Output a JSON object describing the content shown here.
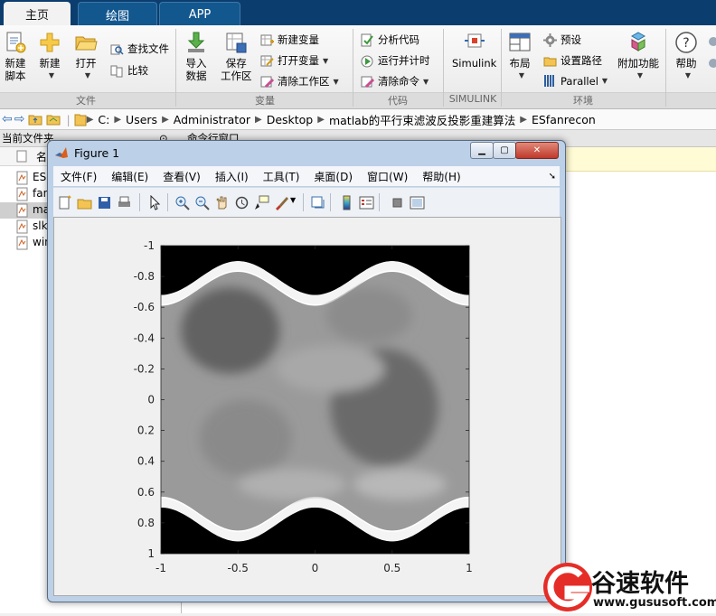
{
  "tabs": [
    {
      "label": "主页",
      "active": true
    },
    {
      "label": "绘图",
      "active": false
    },
    {
      "label": "APP",
      "active": false
    }
  ],
  "ribbon": {
    "file": {
      "new_script": "新建\n脚本",
      "new": "新建",
      "open": "打开",
      "find_files": "查找文件",
      "compare": "比较",
      "group": "文件"
    },
    "variable": {
      "import": "导入\n数据",
      "save_ws": "保存\n工作区",
      "new_var": "新建变量",
      "open_var": "打开变量",
      "clear_ws": "清除工作区",
      "group": "变量"
    },
    "code": {
      "analyze": "分析代码",
      "run_time": "运行并计时",
      "clear_cmd": "清除命令",
      "group": "代码"
    },
    "simulink": {
      "label": "Simulink",
      "group": "SIMULINK"
    },
    "env": {
      "layout": "布局",
      "prefs": "预设",
      "set_path": "设置路径",
      "parallel": "Parallel",
      "addons": "附加功能",
      "group": "环境"
    },
    "resources": {
      "help": "帮助"
    }
  },
  "address": {
    "crumbs": [
      "C:",
      "Users",
      "Administrator",
      "Desktop",
      "matlab的平行束滤波反投影重建算法",
      "ESfanrecon"
    ]
  },
  "left_panel": {
    "title": "当前文件夹",
    "column": "名",
    "files": [
      "ES",
      "fan",
      "ma",
      "slk",
      "win"
    ]
  },
  "right_panel": {
    "title": "命令行窗口"
  },
  "figure": {
    "title": "Figure 1",
    "menu": [
      "文件(F)",
      "编辑(E)",
      "查看(V)",
      "插入(I)",
      "工具(T)",
      "桌面(D)",
      "窗口(W)",
      "帮助(H)"
    ],
    "tools": [
      "new-figure-icon",
      "open-icon",
      "save-icon",
      "print-icon",
      "pointer-icon",
      "zoom-in-icon",
      "zoom-out-icon",
      "pan-icon",
      "rotate-icon",
      "data-cursor-icon",
      "brush-icon",
      "link-icon",
      "colorbar-icon",
      "legend-icon",
      "hide-tools-icon",
      "show-tools-icon"
    ]
  },
  "chart_data": {
    "type": "heatmap",
    "title": "",
    "xlabel": "",
    "ylabel": "",
    "xlim": [
      -1,
      1
    ],
    "ylim": [
      1,
      -1
    ],
    "y_reversed": true,
    "xticks": [
      "-1",
      "-0.5",
      "0",
      "0.5",
      "1"
    ],
    "yticks": [
      "-1",
      "-0.8",
      "-0.6",
      "-0.4",
      "-0.2",
      "0",
      "0.2",
      "0.4",
      "0.6",
      "0.8",
      "1"
    ],
    "colormap": "gray",
    "description_values": {
      "sinusoid_top_boundary": [
        [
          -1,
          -0.68
        ],
        [
          -0.5,
          -0.9
        ],
        [
          0,
          -0.67
        ],
        [
          0.5,
          -0.9
        ],
        [
          1,
          -0.68
        ]
      ],
      "sinusoid_bottom_boundary": [
        [
          -1,
          0.7
        ],
        [
          -0.5,
          0.92
        ],
        [
          0,
          0.68
        ],
        [
          0.5,
          0.92
        ],
        [
          1,
          0.7
        ]
      ]
    }
  },
  "watermark": {
    "brand": "谷速软件",
    "url": "www.gususoft.com"
  }
}
